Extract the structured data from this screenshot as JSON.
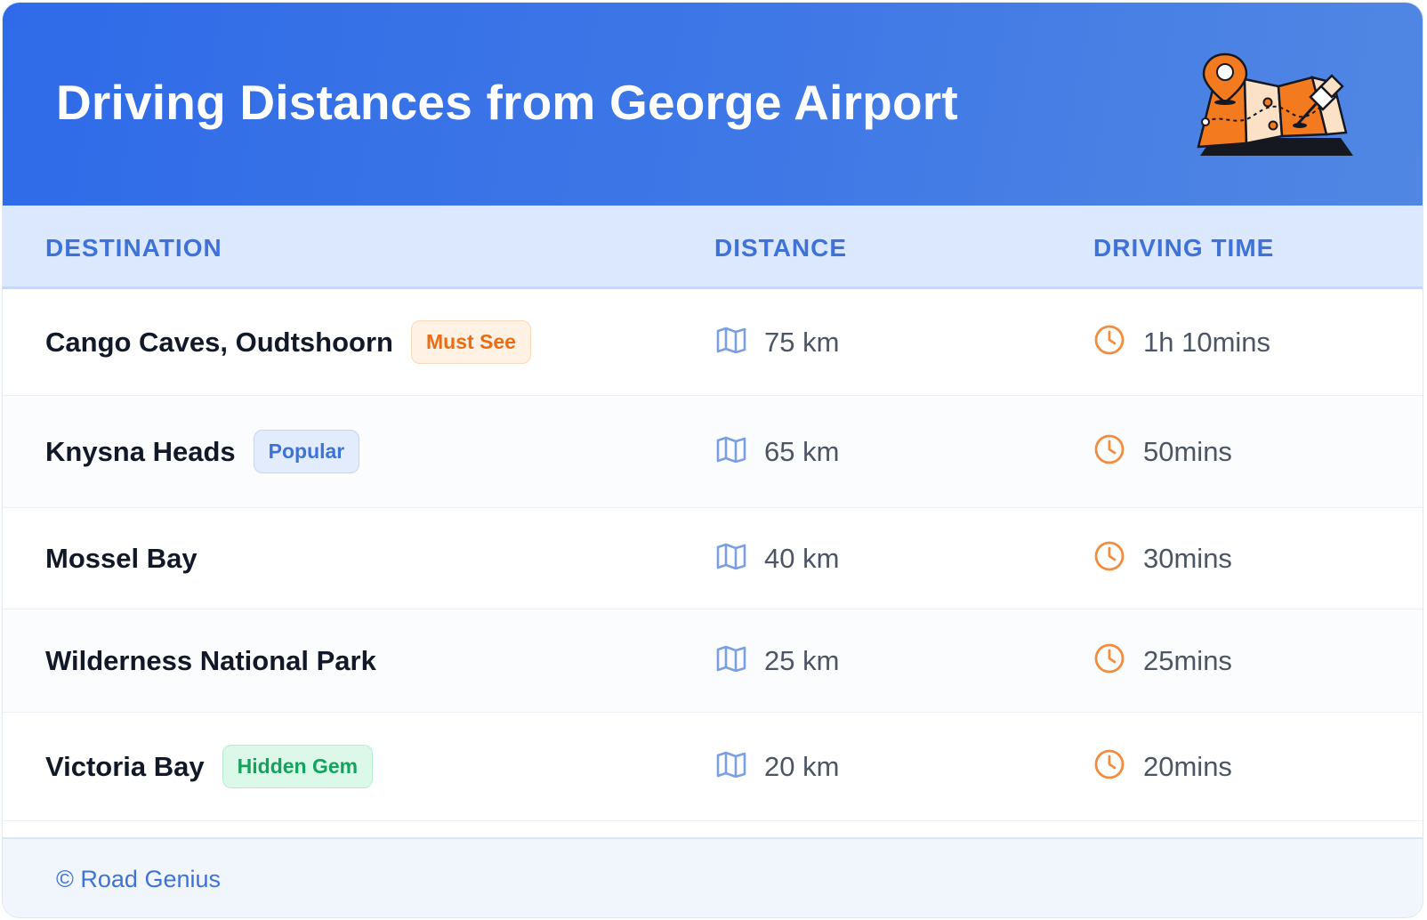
{
  "header": {
    "title": "Driving Distances from George Airport",
    "illustration_icon": "folded-map-with-pins-icon",
    "gradient_start": "#2f6be8",
    "gradient_end": "#5187e3"
  },
  "table": {
    "columns": [
      "DESTINATION",
      "DISTANCE",
      "DRIVING TIME"
    ],
    "distance_icon": "map-icon",
    "time_icon": "clock-icon",
    "rows": [
      {
        "destination": "Cango Caves, Oudtshoorn",
        "badge": "Must See",
        "badge_color": "orange",
        "distance": "75 km",
        "time": "1h 10mins"
      },
      {
        "destination": "Knysna Heads",
        "badge": "Popular",
        "badge_color": "blue",
        "distance": "65 km",
        "time": "50mins"
      },
      {
        "destination": "Mossel Bay",
        "badge": "",
        "badge_color": "",
        "distance": "40 km",
        "time": "30mins"
      },
      {
        "destination": "Wilderness National Park",
        "badge": "",
        "badge_color": "",
        "distance": "25 km",
        "time": "25mins"
      },
      {
        "destination": "Victoria Bay",
        "badge": "Hidden Gem",
        "badge_color": "green",
        "distance": "20 km",
        "time": "20mins"
      }
    ]
  },
  "footer": {
    "text": "© Road Genius"
  },
  "colors": {
    "accent_blue": "#3f72d8",
    "accent_orange": "#ea6d14",
    "accent_green": "#14a35e"
  }
}
